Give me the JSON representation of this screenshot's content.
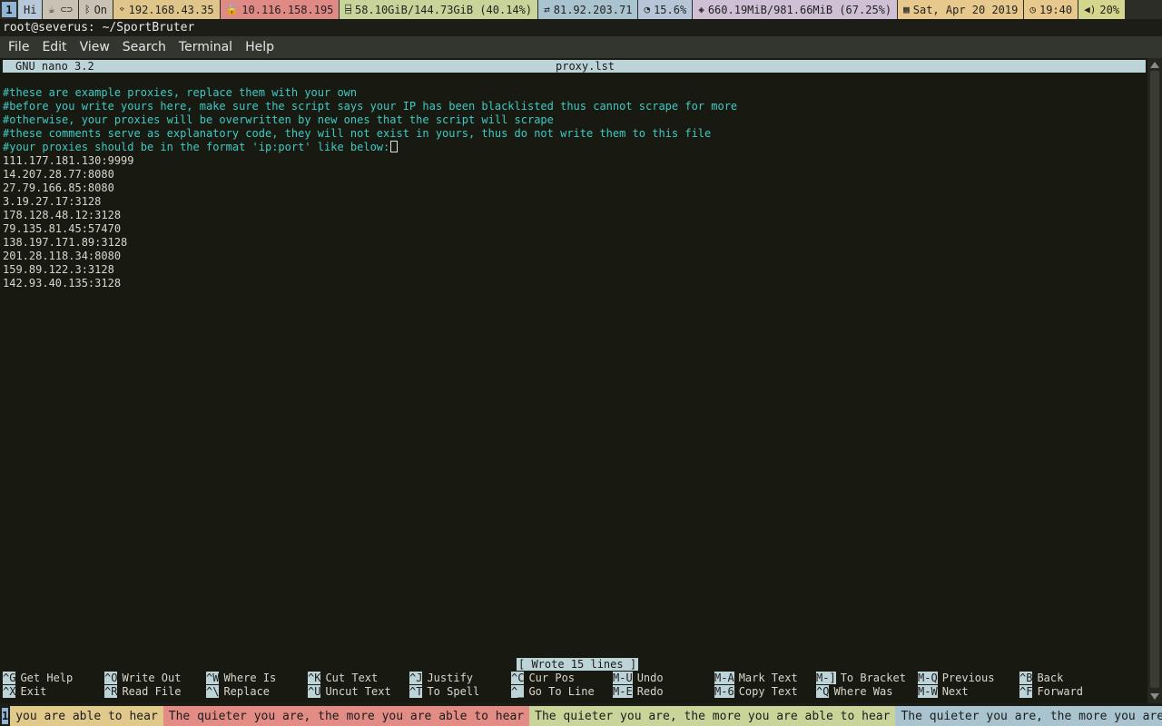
{
  "topbar": {
    "workspace": "1",
    "blocks": [
      {
        "name": "greeting",
        "icon": "",
        "text": "Hi",
        "color": "#b7c9d9"
      },
      {
        "name": "toggles",
        "icon": "☕ ⊂⊃",
        "text": "",
        "color": "#c9c2b4"
      },
      {
        "name": "bluetooth",
        "icon": "ᛒ",
        "text": "On",
        "color": "#c9c2b4"
      },
      {
        "name": "wifi",
        "icon": "⌔",
        "text": "192.168.43.35",
        "color": "#dfc58a"
      },
      {
        "name": "vpn",
        "icon": "🔒",
        "text": "10.116.158.195",
        "color": "#e08a86"
      },
      {
        "name": "disk",
        "icon": "⌸",
        "text": "58.10GiB/144.73GiB (40.14%)",
        "color": "#c9d49a"
      },
      {
        "name": "public-ip",
        "icon": "⇄",
        "text": "81.92.203.71",
        "color": "#a9c3cf"
      },
      {
        "name": "cpu",
        "icon": "◔",
        "text": "15.6%",
        "color": "#b6c6d8"
      },
      {
        "name": "memory",
        "icon": "◈",
        "text": "660.19MiB/981.66MiB (67.25%)",
        "color": "#cfc0d6"
      },
      {
        "name": "date",
        "icon": "▦",
        "text": "Sat, Apr 20 2019",
        "color": "#e7c98e"
      },
      {
        "name": "clock",
        "icon": "◷",
        "text": "19:40",
        "color": "#e7c98e"
      },
      {
        "name": "volume",
        "icon": "◀)",
        "text": "20%",
        "color": "#d3d68c"
      }
    ]
  },
  "window": {
    "title": "root@severus: ~/SportBruter",
    "menu": [
      "File",
      "Edit",
      "View",
      "Search",
      "Terminal",
      "Help"
    ]
  },
  "nano": {
    "version": "GNU nano 3.2",
    "filename": "proxy.lst",
    "comments": [
      "#these are example proxies, replace them with your own",
      "#before you write yours here, make sure the script says your IP has been blacklisted thus cannot scrape for more",
      "#otherwise, your proxies will be overwritten by new ones that the script will scrape",
      "#these comments serve as explanatory code, they will not exist in yours, thus do not write them to this file",
      "#your proxies should be in the format 'ip:port' like below:"
    ],
    "proxies": [
      "111.177.181.130:9999",
      "14.207.28.77:8080",
      "27.79.166.85:8080",
      "3.19.27.17:3128",
      "178.128.48.12:3128",
      "79.135.81.45:57470",
      "138.197.171.89:3128",
      "201.28.118.34:8080",
      "159.89.122.3:3128",
      "142.93.40.135:3128"
    ],
    "status": "[ Wrote 15 lines ]",
    "shortcuts_row1": [
      {
        "key": "^G",
        "label": "Get Help"
      },
      {
        "key": "^O",
        "label": "Write Out"
      },
      {
        "key": "^W",
        "label": "Where Is"
      },
      {
        "key": "^K",
        "label": "Cut Text"
      },
      {
        "key": "^J",
        "label": "Justify"
      },
      {
        "key": "^C",
        "label": "Cur Pos"
      },
      {
        "key": "M-U",
        "label": "Undo"
      },
      {
        "key": "M-A",
        "label": "Mark Text"
      },
      {
        "key": "M-]",
        "label": "To Bracket"
      },
      {
        "key": "M-Q",
        "label": "Previous"
      },
      {
        "key": "^B",
        "label": "Back"
      }
    ],
    "shortcuts_row2": [
      {
        "key": "^X",
        "label": "Exit"
      },
      {
        "key": "^R",
        "label": "Read File"
      },
      {
        "key": "^\\",
        "label": "Replace"
      },
      {
        "key": "^U",
        "label": "Uncut Text"
      },
      {
        "key": "^T",
        "label": "To Spell"
      },
      {
        "key": "^_",
        "label": "Go To Line"
      },
      {
        "key": "M-E",
        "label": "Redo"
      },
      {
        "key": "M-6",
        "label": "Copy Text"
      },
      {
        "key": "^Q",
        "label": "Where Was"
      },
      {
        "key": "M-W",
        "label": "Next"
      },
      {
        "key": "^F",
        "label": "Forward"
      }
    ]
  },
  "bottombar": {
    "workspace": "1",
    "ticker": [
      {
        "text": "you are able to hear",
        "color": "#e0c98a"
      },
      {
        "text": "The quieter you are, the more you are able to hear",
        "color": "#e38c86"
      },
      {
        "text": "The quieter you are, the more you are able to hear",
        "color": "#c9d49a"
      },
      {
        "text": "The quieter you are, the more you are able to hear",
        "color": "#a9c3cf"
      }
    ]
  },
  "colors": {
    "comment": "#3ec9c4",
    "terminal_bg": "#181a12",
    "nano_bar": "#bcd4d8"
  }
}
